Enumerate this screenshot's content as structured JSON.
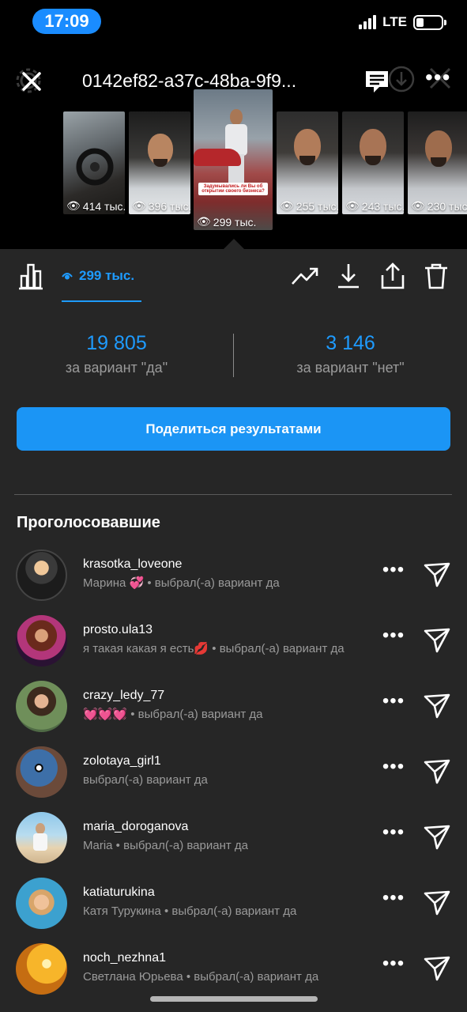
{
  "status": {
    "time": "17:09",
    "network": "LTE"
  },
  "header": {
    "title": "0142ef82-a37c-48ba-9f9..."
  },
  "thumbnails": [
    {
      "views": "414 тыс.",
      "caption": ""
    },
    {
      "views": "396 тыс.",
      "caption": ""
    },
    {
      "views": "299 тыс.",
      "caption": "Задумывались ли Вы об открытии своего бизнеса?"
    },
    {
      "views": "255 тыс.",
      "caption": ""
    },
    {
      "views": "243 тыс.",
      "caption": ""
    },
    {
      "views": "230 тыс.",
      "caption": ""
    }
  ],
  "toolbar": {
    "views": "299 тыс."
  },
  "stats": {
    "yes_count": "19 805",
    "yes_label": "за вариант \"да\"",
    "no_count": "3 146",
    "no_label": "за вариант \"нет\""
  },
  "share_button": "Поделиться результатами",
  "voters_title": "Проголосовавшие",
  "voters": [
    {
      "username": "krasotka_loveone",
      "subtitle": "Марина 💞 • выбрал(-а) вариант да"
    },
    {
      "username": "prosto.ula13",
      "subtitle": "я такая какая я есть💋 • выбрал(-а) вариант да"
    },
    {
      "username": "crazy_ledy_77",
      "subtitle": "💓💓💓 • выбрал(-а) вариант да"
    },
    {
      "username": "zolotaya_girl1",
      "subtitle": "выбрал(-а) вариант да"
    },
    {
      "username": "maria_doroganova",
      "subtitle": "Maria • выбрал(-а) вариант да"
    },
    {
      "username": "katiaturukina",
      "subtitle": "Катя Турукина • выбрал(-а) вариант да"
    },
    {
      "username": "noch_nezhna1",
      "subtitle": "Светлана Юрьева • выбрал(-а) вариант да"
    }
  ],
  "colors": {
    "accent": "#1e9bff",
    "button": "#1b95f5",
    "background": "#262626",
    "top": "#000000"
  },
  "icons": [
    "close-icon",
    "comment-icon",
    "more-icon",
    "stats-icon",
    "eye-icon",
    "trending-icon",
    "download-icon",
    "share-icon",
    "trash-icon",
    "send-icon"
  ]
}
